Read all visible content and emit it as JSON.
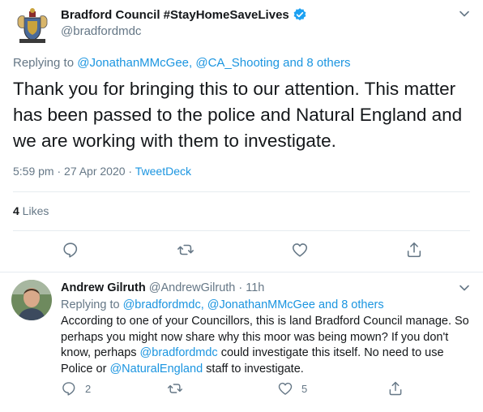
{
  "main": {
    "display_name": "Bradford Council #StayHomeSaveLives",
    "handle": "@bradfordmdc",
    "replying_prefix": "Replying to ",
    "replying_users": "@JonathanMMcGee, @CA_Shooting",
    "replying_and": " and ",
    "replying_others": "8 others",
    "text": "Thank you for bringing this to our attention. This matter has been passed to the police and Natural England and we are working with them to investigate.",
    "timestamp": "5:59 pm · 27 Apr 2020 · ",
    "source": "TweetDeck",
    "likes_count": "4",
    "likes_label": " Likes"
  },
  "reply": {
    "display_name": "Andrew Gilruth",
    "handle": " @AndrewGilruth · 11h",
    "replying_prefix": "Replying to ",
    "replying_users": "@bradfordmdc, @JonathanMMcGee",
    "replying_and": " and ",
    "replying_others": "8 others",
    "text_1": "According to one of your Councillors, this is land Bradford Council manage. So perhaps you might now share why this moor was being mown? If you don't know, perhaps ",
    "mention_1": "@bradfordmdc",
    "text_2": " could investigate this itself. No need to use Police or ",
    "mention_2": "@NaturalEngland",
    "text_3": " staff to investigate.",
    "reply_count": "2",
    "like_count": "5"
  },
  "colors": {
    "link": "#1b95e0",
    "muted": "#657786",
    "text": "#14171a",
    "divider": "#e6ecf0",
    "verified": "#1da1f2"
  },
  "icons": [
    "council-crest-icon",
    "verified-badge-icon",
    "chevron-down-icon",
    "reply-icon",
    "retweet-icon",
    "like-icon",
    "share-icon"
  ]
}
